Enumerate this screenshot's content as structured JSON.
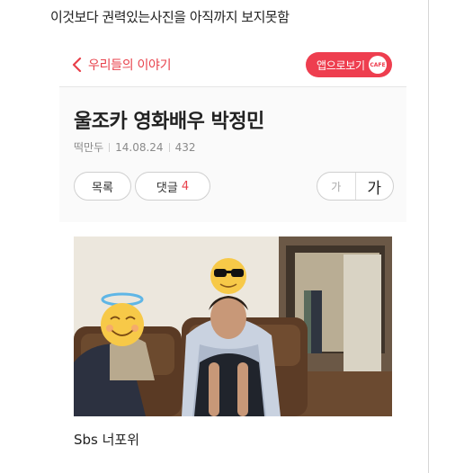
{
  "caption": "이것보다 권력있는사진을 아직까지 보지못함",
  "topbar": {
    "back_label": "우리들의 이야기",
    "app_button_label": "앱으로보기",
    "cafe_badge": "CAFE"
  },
  "post": {
    "title": "울조카 영화배우 박정민",
    "author": "떡만두",
    "date": "14.08.24",
    "views": "432",
    "body_text": "Sbs 너포위"
  },
  "buttons": {
    "list_label": "목록",
    "comment_label": "댓글",
    "comment_count": "4",
    "font_small_label": "가",
    "font_large_label": "가"
  },
  "colors": {
    "accent": "#ee3e4f",
    "link_red": "#e8414b"
  },
  "icons": {
    "back": "chevron-left-icon",
    "halo_emoji": "smiling-face-with-halo",
    "sunglasses_emoji": "smiling-face-with-sunglasses",
    "neutral_emoji": "neutral-face"
  }
}
